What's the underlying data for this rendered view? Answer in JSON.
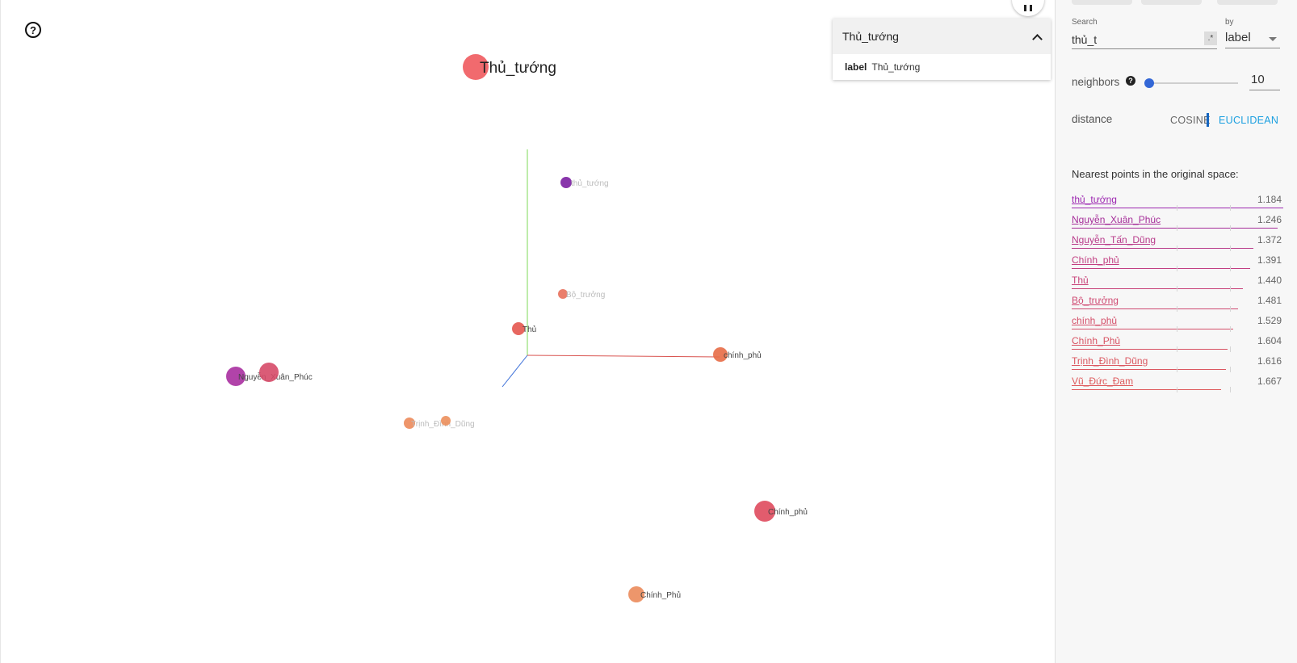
{
  "canvas": {
    "help_icon": "help-circle-icon",
    "top_button_icon": "pause-icon",
    "focused_label": "Thủ_tướng",
    "points": [
      {
        "label": "thủ_tướng",
        "color": "#7b1fa2",
        "faint": true
      },
      {
        "label": "Bộ_trưởng",
        "color": "#e8705b",
        "faint": true
      },
      {
        "label": "Thủ",
        "color": "#e4574f",
        "faint": false
      },
      {
        "label": "chính_phủ",
        "color": "#e76b46",
        "faint": false
      },
      {
        "label": "Nguyễn_Xuân_Phúc",
        "color": "#a92fa0",
        "faint": false
      },
      {
        "label": "Nguyễn_Tấn_Dũng",
        "color": "#d64a68",
        "faint": false
      },
      {
        "label": "Trịnh_Đình_Dũng",
        "color": "#ec8a5a",
        "faint": true
      },
      {
        "label": "Vũ_Đức_Đam",
        "color": "#ec8f5c",
        "faint": true
      },
      {
        "label": "Chính_phủ",
        "color": "#df4a5d",
        "faint": false
      },
      {
        "label": "Chính_Phủ",
        "color": "#eb8b5b",
        "faint": false
      }
    ]
  },
  "info_card": {
    "title": "Thủ_tướng",
    "field_name": "label",
    "field_value": "Thủ_tướng",
    "collapse_icon": "chevron-up-icon"
  },
  "panel": {
    "search_label": "Search",
    "search_value": "thủ_t",
    "regex_label": ".*",
    "by_label": "by",
    "by_value": "label",
    "neighbors_label": "neighbors",
    "neighbors_value": "10",
    "neighbors_fraction": 0.0,
    "distance_label": "distance",
    "cosine_label": "COSINE",
    "euclidean_label": "EUCLIDEAN",
    "nearest_title": "Nearest points in the original space:",
    "nearest": [
      {
        "name": "thủ_tướng",
        "value": "1.184",
        "color": "#9c27b0"
      },
      {
        "name": "Nguyễn_Xuân_Phúc",
        "value": "1.246",
        "color": "#a52d99"
      },
      {
        "name": "Nguyễn_Tấn_Dũng",
        "value": "1.372",
        "color": "#b83a8a"
      },
      {
        "name": "Chính_phủ",
        "value": "1.391",
        "color": "#c23f82"
      },
      {
        "name": "Thủ",
        "value": "1.440",
        "color": "#c8437a"
      },
      {
        "name": "Bộ_trưởng",
        "value": "1.481",
        "color": "#cf4972"
      },
      {
        "name": "chính_phủ",
        "value": "1.529",
        "color": "#d44f69"
      },
      {
        "name": "Chính_Phủ",
        "value": "1.604",
        "color": "#d85363"
      },
      {
        "name": "Trịnh_Đình_Dũng",
        "value": "1.616",
        "color": "#db5760"
      },
      {
        "name": "Vũ_Đức_Đam",
        "value": "1.667",
        "color": "#de5a5c"
      }
    ]
  }
}
